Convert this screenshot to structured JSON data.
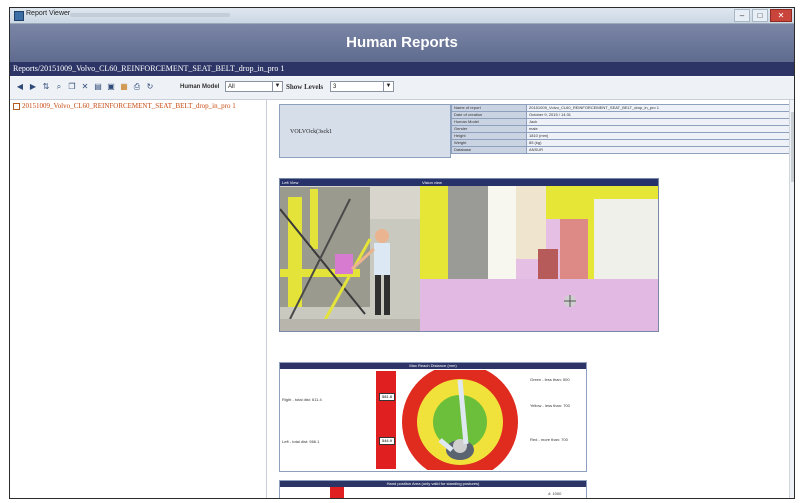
{
  "window": {
    "title": "Report Viewer"
  },
  "banner": {
    "title": "Human Reports"
  },
  "path": "Reports/20151009_Volvo_CL60_REINFORCEMENT_SEAT_BELT_drop_in_pro 1",
  "toolbar": {
    "human_model_label": "Human Model",
    "human_model_value": "All",
    "show_levels_label": "Show Levels",
    "show_levels_value": "3"
  },
  "tree": {
    "item": "20151009_Volvo_CL60_REINFORCEMENT_SEAT_BELT_drop_in_pro 1"
  },
  "report_info": {
    "name": "VOLVOck(3sck1",
    "rows": [
      {
        "key": "Name of report",
        "value": "20151009_Volvo_CL60_REINFORCEMENT_SEAT_BELT_drop_in_pro 1"
      },
      {
        "key": "Date of creation",
        "value": "October 9, 2015 / 14:31"
      },
      {
        "key": "Human Model",
        "value": "Jack"
      },
      {
        "key": "Gender",
        "value": "male"
      },
      {
        "key": "Height",
        "value": "1810 (mm)"
      },
      {
        "key": "Weight",
        "value": "85 (kg)"
      },
      {
        "key": "Database",
        "value": "ANSUR"
      }
    ]
  },
  "views": {
    "left_label": "Left View",
    "vision_label": "Vision view"
  },
  "reach": {
    "title": "Max Reach Distance (mm)",
    "right_label": "Right - total dist: 611.4",
    "right_value": "581.8",
    "left_label": "Left - total dist: 566.1",
    "left_value": "544.9",
    "green_text": "Green - less than: 500",
    "yellow_text": "Yellow - less than: 700",
    "red_text": "Red - more than: 700"
  },
  "hand": {
    "title": "Hand position Area (only valid for standing postures)",
    "value": "4: 1000"
  },
  "colors": {
    "banner": "#6b779b",
    "pathbar": "#2c3566",
    "tree_text": "#c64a12"
  }
}
